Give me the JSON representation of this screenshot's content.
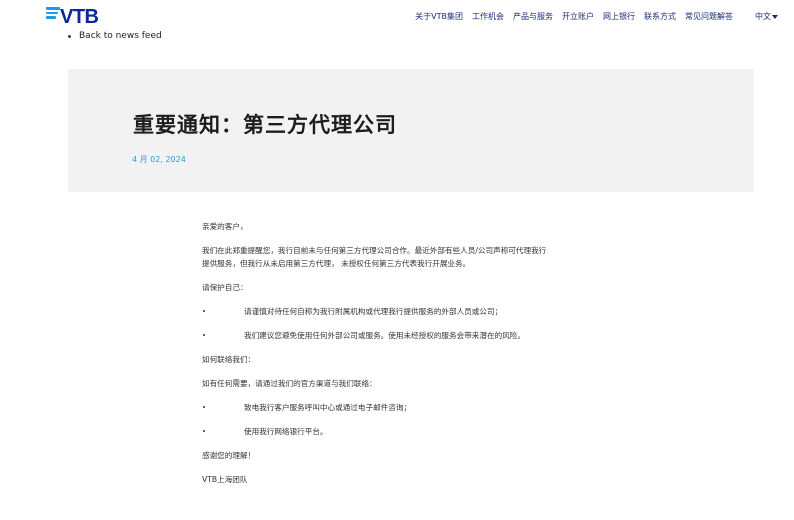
{
  "header": {
    "logo_text": "VTB",
    "nav": [
      "关于VTB集团",
      "工作机会",
      "产品与服务",
      "开立账户",
      "网上银行",
      "联系方式",
      "常见问题解答"
    ],
    "language": "中文"
  },
  "back_link": "Back to news feed",
  "hero": {
    "title": "重要通知：第三方代理公司",
    "date": "4 月 02, 2024"
  },
  "body": {
    "greeting": "亲爱的客户，",
    "intro_line1": "我们在此郑重提醒您，我行目前未与任何第三方代理公司合作。最近外部有些人员/公司声称可代理我行",
    "intro_line2": "提供服务，但我行从未启用第三方代理， 未授权任何第三方代表我行开展业务。",
    "protect_heading": "请保护自己：",
    "protect_items": [
      "请谨慎对待任何自称为我行附属机构或代理我行提供服务的外部人员或公司；",
      "我们建议您避免使用任何外部公司或服务。使用未经授权的服务会带来潜在的风险。"
    ],
    "contact_heading": "如何联络我们：",
    "contact_intro": "如有任何需要，请通过我们的官方渠道与我们联络：",
    "contact_items": [
      "致电我行客户服务呼叫中心或通过电子邮件咨询；",
      "使用我行网络银行平台。"
    ],
    "thanks": "感谢您的理解！",
    "signature": "VTB上海团队"
  }
}
